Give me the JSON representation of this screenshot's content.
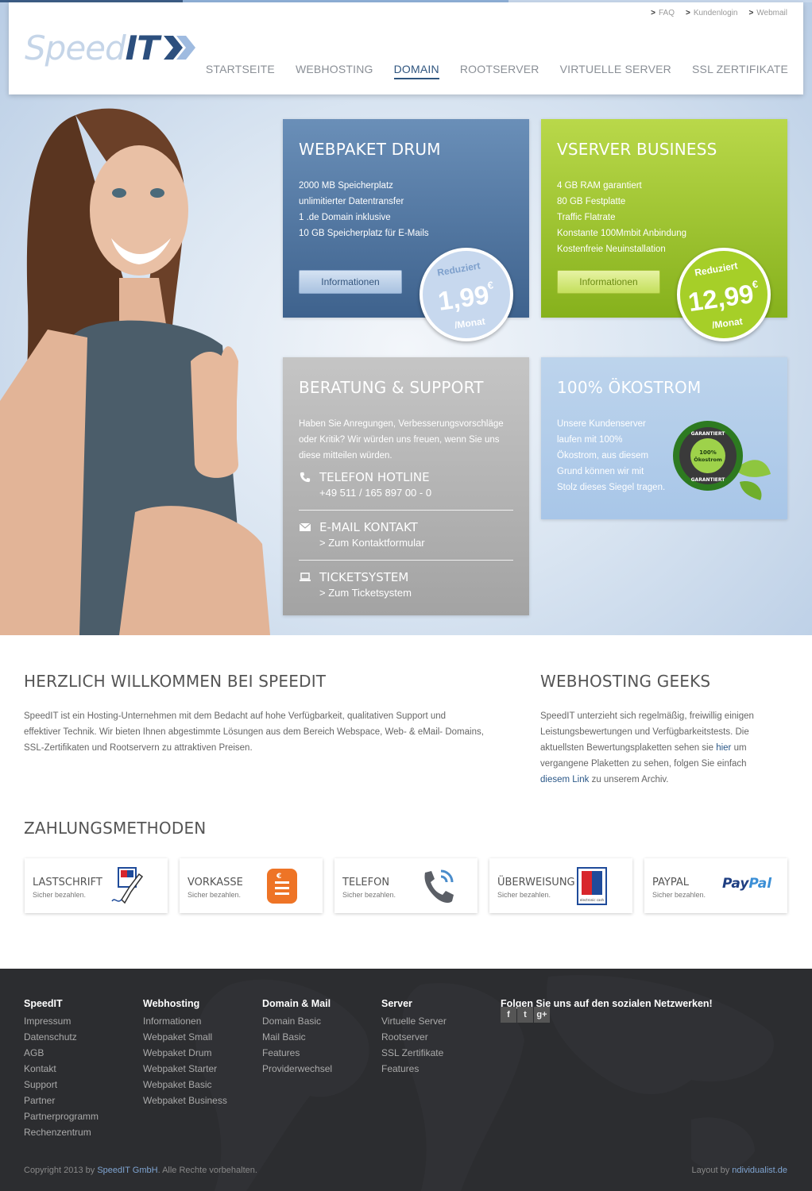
{
  "header": {
    "brand_speed": "Speed",
    "brand_it": "IT",
    "toplinks": [
      "FAQ",
      "Kundenlogin",
      "Webmail"
    ],
    "nav": [
      "STARTSEITE",
      "WEBHOSTING",
      "DOMAIN",
      "ROOTSERVER",
      "VIRTUELLE SERVER",
      "SSL ZERTIFIKATE"
    ],
    "nav_active": "DOMAIN"
  },
  "hero": {
    "webpaket": {
      "title": "WEBPAKET DRUM",
      "lines": [
        "2000 MB Speicherplatz",
        "unlimitierter Datentransfer",
        "1 .de Domain inklusive",
        "10 GB Speicherplatz für E-Mails"
      ],
      "button": "Informationen",
      "badge_top": "Reduziert",
      "price_main": "1,99",
      "price_currency": "€",
      "price_unit": "/Monat"
    },
    "vserver": {
      "title": "VSERVER BUSINESS",
      "lines": [
        "4 GB RAM garantiert",
        "80 GB Festplatte",
        "Traffic Flatrate",
        "Konstante 100Mmbit Anbindung",
        "Kostenfreie Neuinstallation"
      ],
      "button": "Informationen",
      "badge_top": "Reduziert",
      "price_main": "12,99",
      "price_currency": "€",
      "price_unit": "/Monat"
    },
    "support": {
      "title": "BERATUNG & SUPPORT",
      "text_lines": [
        "Haben Sie Anregungen, Verbesserungsvorschläge",
        "oder Kritik? Wir würden uns freuen, wenn Sie uns",
        "diese mitteilen würden."
      ],
      "hotline_title": "TELEFON HOTLINE",
      "hotline_value": "+49 511 / 165 897 00 - 0",
      "mail_title": "E-MAIL KONTAKT",
      "mail_link": "> Zum Kontaktformular",
      "ticket_title": "TICKETSYSTEM",
      "ticket_link": "> Zum Ticketsystem"
    },
    "oeko": {
      "title": "100% ÖKOSTROM",
      "text_lines": [
        "Unsere Kundenserver",
        "laufen mit 100%",
        "Ökostrom, aus diesem",
        "Grund können wir mit",
        "Stolz dieses Siegel tragen."
      ],
      "seal_top": "GARANTIERT",
      "seal_mid1": "100%",
      "seal_mid2": "Ökostrom",
      "seal_bottom": "GARANTIERT"
    }
  },
  "welcome": {
    "title": "HERZLICH WILLKOMMEN BEI SPEEDIT",
    "lines": [
      "SpeedIT ist ein Hosting-Unternehmen mit dem Bedacht auf hohe Verfügbarkeit, qualitativen Support und",
      "effektiver Technik. Wir bieten Ihnen abgestimmte Lösungen aus dem Bereich Webspace, Web- & eMail- Domains,",
      "SSL-Zertifikaten und Rootservern zu attraktiven Preisen."
    ]
  },
  "geeks": {
    "title": "WEBHOSTING GEEKS",
    "l1": "SpeedIT unterzieht sich regelmäßig, freiwillig einigen",
    "l2": "Leistungsbewertungen und Verfügbarkeitstests. Die",
    "l3a": "aktuellsten Bewertungsplaketten sehen sie ",
    "l3link": "hier",
    "l3b": " um",
    "l4": "vergangene Plaketten zu sehen, folgen Sie einfach",
    "l5link": "diesem Link",
    "l5b": " zu unserem Archiv."
  },
  "payments": {
    "title": "ZAHLUNGSMETHODEN",
    "items": [
      {
        "name": "LASTSCHRIFT",
        "sub": "Sicher bezahlen.",
        "icon": "direct-debit-icon"
      },
      {
        "name": "VORKASSE",
        "sub": "Sicher bezahlen.",
        "icon": "prepayment-icon"
      },
      {
        "name": "TELEFON",
        "sub": "Sicher bezahlen.",
        "icon": "phone-icon"
      },
      {
        "name": "ÜBERWEISUNG",
        "sub": "Sicher bezahlen.",
        "icon": "ec-card-icon"
      },
      {
        "name": "PAYPAL",
        "sub": "Sicher bezahlen.",
        "icon": "paypal-icon"
      }
    ],
    "ec_label": "electronic cash",
    "paypal_pay": "Pay",
    "paypal_pal": "Pal"
  },
  "footer": {
    "col1": {
      "head": "SpeedIT",
      "items": [
        "Impressum",
        "Datenschutz",
        "AGB",
        "Kontakt",
        "Support",
        "Partner",
        "Partnerprogramm",
        "Rechenzentrum"
      ]
    },
    "col2": {
      "head": "Webhosting",
      "items": [
        "Informationen",
        "Webpaket Small",
        "Webpaket Drum",
        "Webpaket Starter",
        "Webpaket Basic",
        "Webpaket Business"
      ]
    },
    "col3": {
      "head": "Domain & Mail",
      "items": [
        "Domain Basic",
        "Mail Basic",
        "Features",
        "Providerwechsel"
      ]
    },
    "col4": {
      "head": "Server",
      "items": [
        "Virtuelle Server",
        "Rootserver",
        "SSL Zertifikate",
        "Features"
      ]
    },
    "social_head": "Folgen Sie uns auf den sozialen Netzwerken!",
    "social": [
      "f",
      "t",
      "g+"
    ],
    "copy_pre": "Copyright 2013 by ",
    "copy_link": "SpeedIT GmbH",
    "copy_post": ". Alle Rechte vorbehalten.",
    "layout_pre": "Layout by ",
    "layout_link": "ndividualist.de"
  },
  "colors": {
    "brand_blue": "#2f557f",
    "green": "#a6cf28",
    "footer_bg": "#2c2d30"
  }
}
